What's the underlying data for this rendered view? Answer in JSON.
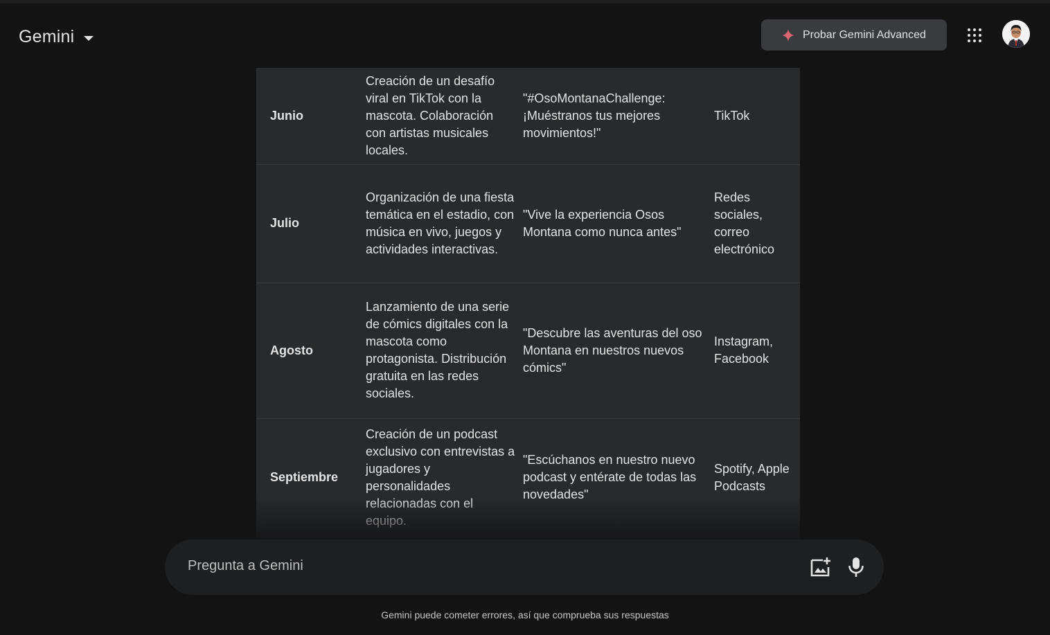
{
  "header": {
    "app_name": "Gemini",
    "advanced_button_label": "Probar Gemini Advanced",
    "accent_spark_color": "#d96570",
    "icons": [
      "chevron-down-icon",
      "spark-icon",
      "apps-grid-icon",
      "avatar"
    ]
  },
  "table": {
    "rows": [
      {
        "month": "Junio",
        "activity": "Creación de un desafío viral en TikTok con la mascota. Colaboración con artistas musicales locales.",
        "slogan": "\"#OsoMontanaChallenge: ¡Muéstranos tus mejores movimientos!\"",
        "channels": "TikTok"
      },
      {
        "month": "Julio",
        "activity": "Organización de una fiesta temática en el estadio, con música en vivo, juegos y actividades interactivas.",
        "slogan": "\"Vive la experiencia Osos Montana como nunca antes\"",
        "channels": "Redes sociales, correo electrónico"
      },
      {
        "month": "Agosto",
        "activity": "Lanzamiento de una serie de cómics digitales con la mascota como protagonista. Distribución gratuita en las redes sociales.",
        "slogan": "\"Descubre las aventuras del oso Montana en nuestros nuevos cómics\"",
        "channels": "Instagram, Facebook"
      },
      {
        "month": "Septiembre",
        "activity": "Creación de un podcast exclusivo con entrevistas a jugadores y personalidades relacionadas con el equipo.",
        "slogan": "\"Escúchanos en nuestro nuevo podcast y entérate de todas las novedades\"",
        "channels": "Spotify, Apple Podcasts"
      }
    ]
  },
  "input": {
    "placeholder": "Pregunta a Gemini",
    "icons": [
      "image-upload-icon",
      "mic-icon"
    ]
  },
  "footer": {
    "disclaimer": "Gemini puede cometer errores, así que comprueba sus respuestas"
  }
}
